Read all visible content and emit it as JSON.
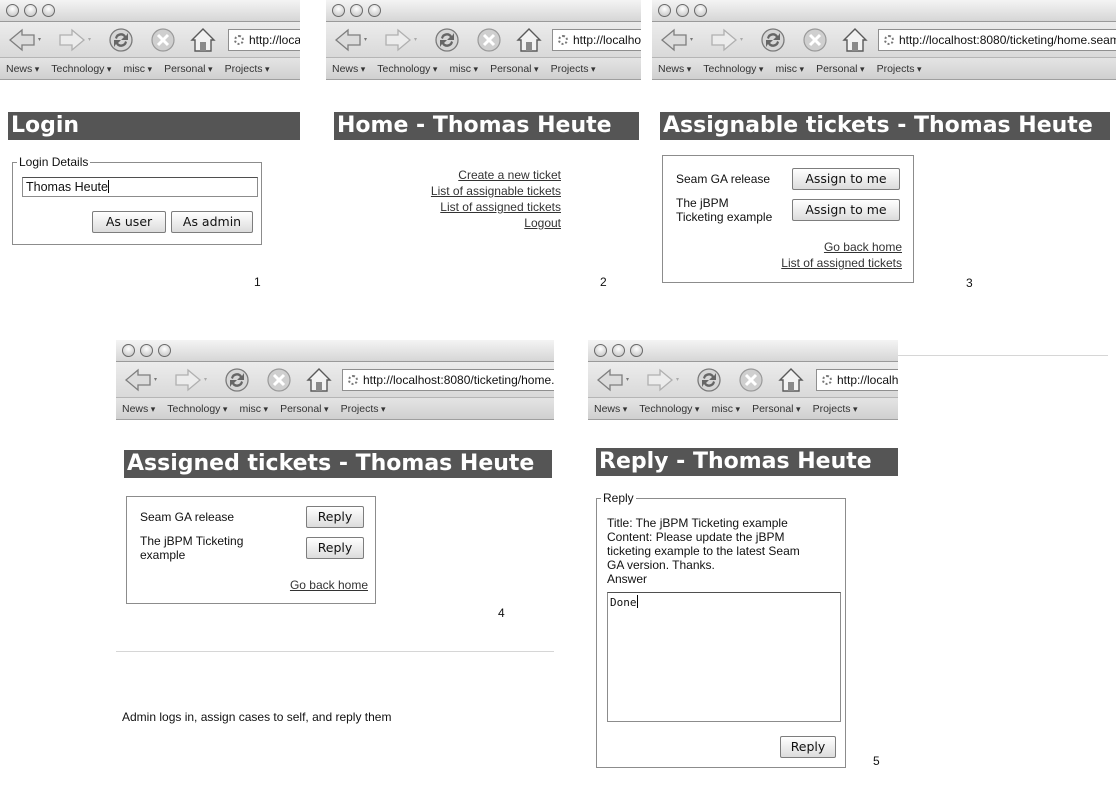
{
  "browser": {
    "bookmarks": [
      "News",
      "Technology",
      "misc",
      "Personal",
      "Projects"
    ],
    "url_full": "http://localhost:8080/ticketing/home.seam",
    "colors": {
      "heading_bg": "#555555",
      "heading_fg": "#ffffff"
    }
  },
  "login": {
    "heading": "Login",
    "legend": "Login Details",
    "username_value": "Thomas Heute",
    "as_user": "As user",
    "as_admin": "As admin",
    "step": "1"
  },
  "home": {
    "heading": "Home - Thomas Heute",
    "links": [
      "Create a new ticket",
      "List of assignable tickets",
      "List of assigned tickets",
      "Logout"
    ],
    "step": "2"
  },
  "assignable": {
    "heading": "Assignable tickets - Thomas Heute",
    "tickets": [
      {
        "title": "Seam GA release",
        "action": "Assign to me"
      },
      {
        "title_line1": "The jBPM",
        "title_line2": "Ticketing example",
        "action": "Assign to me"
      }
    ],
    "link_home": "Go back home",
    "link_assigned": "List of assigned tickets",
    "step": "3"
  },
  "assigned": {
    "heading": "Assigned tickets - Thomas Heute",
    "tickets": [
      {
        "title": "Seam GA release",
        "action": "Reply"
      },
      {
        "title_line1": "The jBPM Ticketing",
        "title_line2": "example",
        "action": "Reply"
      }
    ],
    "link_home": "Go back home",
    "step": "4"
  },
  "reply": {
    "heading": "Reply - Thomas Heute",
    "legend": "Reply",
    "lines": [
      "Title: The jBPM Ticketing example",
      "Content: Please update the jBPM",
      "ticketing example to the latest Seam",
      "GA version. Thanks."
    ],
    "answer_label": "Answer",
    "answer_value": "Done",
    "button": "Reply",
    "step": "5"
  },
  "caption": "Admin logs in, assign cases to self, and reply them"
}
